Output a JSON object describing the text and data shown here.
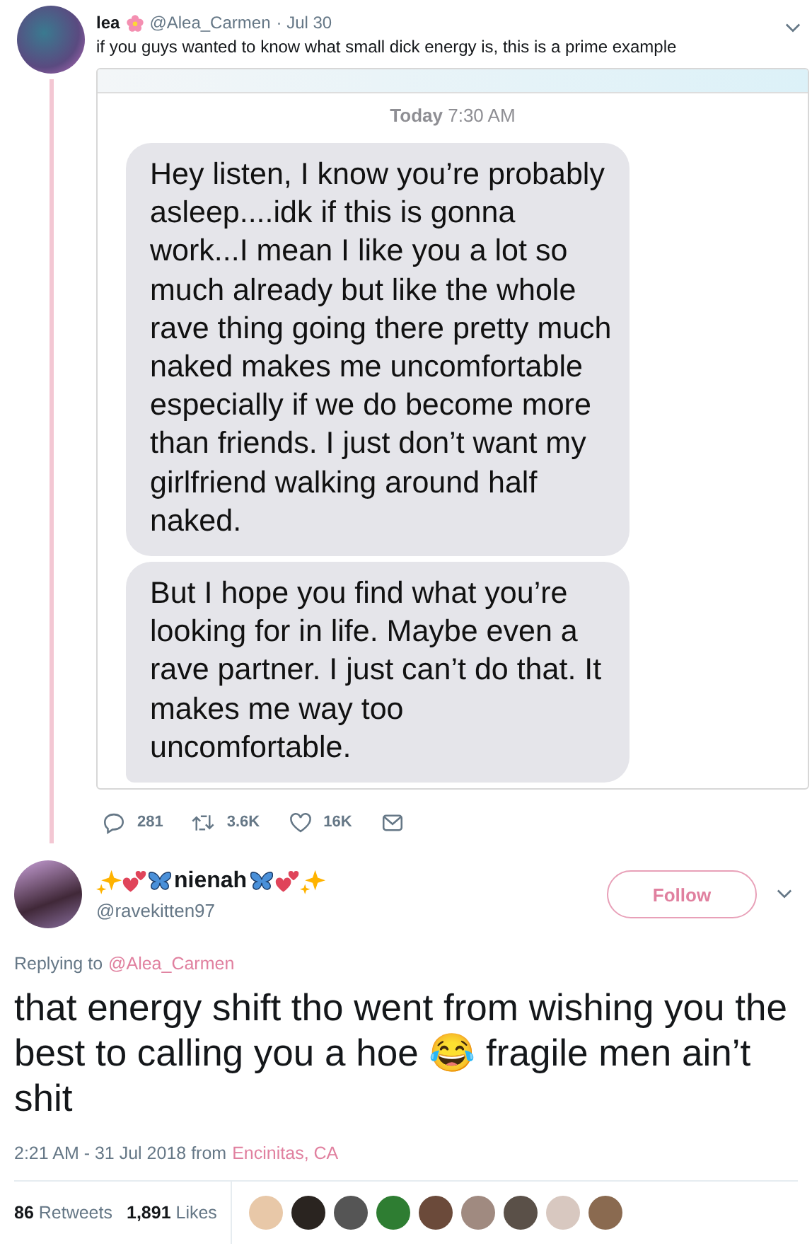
{
  "tweet": {
    "name": "lea",
    "handle": "@Alea_Carmen",
    "date": "· Jul 30",
    "text": "if you guys wanted to know what small dick energy is, this is a prime example",
    "screenshot": {
      "timestamp_bold": "Today",
      "timestamp": "7:30 AM",
      "messages": [
        "Hey listen, I know you’re probably asleep....idk if this is gonna work...I mean I like you a lot so much already but like the whole rave thing going there pretty much naked makes me uncomfortable especially if we do become more than friends. I just don’t want my girlfriend walking around half naked.",
        "But I hope you find what you’re looking for in life. Maybe even a rave partner. I just can’t do that. It makes me way too uncomfortable."
      ]
    },
    "actions": [
      {
        "kind": "reply",
        "count": "281"
      },
      {
        "kind": "retweet",
        "count": "3.6K"
      },
      {
        "kind": "like",
        "count": "16K"
      },
      {
        "kind": "message"
      }
    ]
  },
  "reply": {
    "name": "nienah",
    "handle": "@ravekitten97",
    "follow": "Follow",
    "replying_label": "Replying to",
    "replying_to": "@Alea_Carmen",
    "text": "that energy shift tho went from wishing you the best to calling you a hoe 😂 fragile men ain’t shit",
    "time": "2:21 AM - 31 Jul 2018 from",
    "location": "Encinitas, CA",
    "stats": [
      {
        "count": "86",
        "label": "Retweets"
      },
      {
        "count": "1,891",
        "label": "Likes"
      }
    ],
    "likers": [
      {
        "color": "#e8c8a8"
      },
      {
        "color": "#2a2420"
      },
      {
        "color": "#555555"
      },
      {
        "color": "#2e7d32"
      },
      {
        "color": "#6b4a3a"
      },
      {
        "color": "#a08a80"
      },
      {
        "color": "#5a5048"
      },
      {
        "color": "#d8c8c0"
      },
      {
        "color": "#8a6a50"
      }
    ]
  }
}
